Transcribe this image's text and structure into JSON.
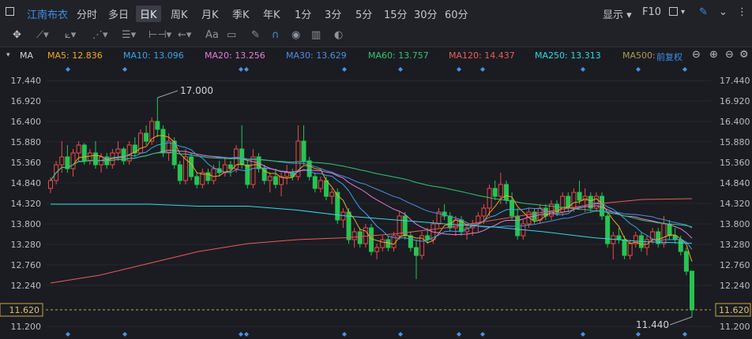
{
  "stock_name": "江南布衣",
  "periods": [
    "分时",
    "多日",
    "日K",
    "周K",
    "月K",
    "季K",
    "年K",
    "1分",
    "3分",
    "5分",
    "15分",
    "30分",
    "60分"
  ],
  "active_period": "日K",
  "toolbar_right": {
    "display_label": "显示",
    "f10_label": "F10"
  },
  "tools": {
    "text_tool": "Aa"
  },
  "indicator_label": "MA",
  "adjust_label": "前复权",
  "ma_legend": [
    {
      "label": "MA5: 12.836",
      "color": "#f5a623"
    },
    {
      "label": "MA10: 13.096",
      "color": "#3aa3f0"
    },
    {
      "label": "MA20: 13.256",
      "color": "#e87bd8"
    },
    {
      "label": "MA30: 13.629",
      "color": "#4b8fe6"
    },
    {
      "label": "MA60: 13.757",
      "color": "#35c46f"
    },
    {
      "label": "MA120: 14.437",
      "color": "#ef5a5a"
    },
    {
      "label": "MA250: 13.313",
      "color": "#36d6e7"
    },
    {
      "label": "MA500:",
      "color": "#b09a55"
    }
  ],
  "chart_data": {
    "type": "candlestick",
    "ylim": [
      11.2,
      17.6
    ],
    "y_ticks": [
      "17.440",
      "16.920",
      "16.400",
      "15.880",
      "15.360",
      "14.840",
      "14.320",
      "13.800",
      "13.280",
      "12.760",
      "12.240",
      "11.200"
    ],
    "current_price": "11.620",
    "max_label": "17.000",
    "min_label": "11.440",
    "candles": [
      [
        14.7,
        14.98,
        14.58,
        14.9
      ],
      [
        14.9,
        15.4,
        14.8,
        15.3
      ],
      [
        15.3,
        15.9,
        15.1,
        15.5
      ],
      [
        15.5,
        15.8,
        15.1,
        15.2
      ],
      [
        15.2,
        15.7,
        15.0,
        15.6
      ],
      [
        15.6,
        15.9,
        15.4,
        15.8
      ],
      [
        15.8,
        15.85,
        15.3,
        15.4
      ],
      [
        15.4,
        15.7,
        15.3,
        15.6
      ],
      [
        15.6,
        15.9,
        15.2,
        15.3
      ],
      [
        15.3,
        15.6,
        15.1,
        15.5
      ],
      [
        15.5,
        15.6,
        15.2,
        15.3
      ],
      [
        15.3,
        15.7,
        15.2,
        15.6
      ],
      [
        15.6,
        15.9,
        15.4,
        15.7
      ],
      [
        15.7,
        15.75,
        15.3,
        15.4
      ],
      [
        15.4,
        15.9,
        15.3,
        15.8
      ],
      [
        15.8,
        16.0,
        15.5,
        15.6
      ],
      [
        15.6,
        16.2,
        15.6,
        16.1
      ],
      [
        16.1,
        16.3,
        15.8,
        15.9
      ],
      [
        15.9,
        16.5,
        15.8,
        16.4
      ],
      [
        16.4,
        17.0,
        16.0,
        16.2
      ],
      [
        16.2,
        16.3,
        15.5,
        15.6
      ],
      [
        15.6,
        16.1,
        15.4,
        15.9
      ],
      [
        15.9,
        16.0,
        15.2,
        15.3
      ],
      [
        15.3,
        15.4,
        14.8,
        14.9
      ],
      [
        14.9,
        15.7,
        14.8,
        15.5
      ],
      [
        15.5,
        15.6,
        14.9,
        15.0
      ],
      [
        15.0,
        15.1,
        14.7,
        14.8
      ],
      [
        14.8,
        15.2,
        14.7,
        15.1
      ],
      [
        15.1,
        15.2,
        14.8,
        14.9
      ],
      [
        14.9,
        15.3,
        14.8,
        15.2
      ],
      [
        15.2,
        15.4,
        15.0,
        15.1
      ],
      [
        15.1,
        15.5,
        15.0,
        15.3
      ],
      [
        15.3,
        15.4,
        15.0,
        15.2
      ],
      [
        15.2,
        15.8,
        15.1,
        15.7
      ],
      [
        15.7,
        16.3,
        15.2,
        15.3
      ],
      [
        15.3,
        15.4,
        14.7,
        14.8
      ],
      [
        14.8,
        15.7,
        14.7,
        15.5
      ],
      [
        15.5,
        15.6,
        15.1,
        15.2
      ],
      [
        15.2,
        15.3,
        14.8,
        14.9
      ],
      [
        14.9,
        15.1,
        14.6,
        15.0
      ],
      [
        15.0,
        15.2,
        14.7,
        14.8
      ],
      [
        14.8,
        15.1,
        14.5,
        15.0
      ],
      [
        15.0,
        15.3,
        14.8,
        15.1
      ],
      [
        15.1,
        15.2,
        14.9,
        15.0
      ],
      [
        15.0,
        16.3,
        14.9,
        15.9
      ],
      [
        15.9,
        16.3,
        15.3,
        15.4
      ],
      [
        15.4,
        15.5,
        14.9,
        15.0
      ],
      [
        15.0,
        15.1,
        14.6,
        14.7
      ],
      [
        14.7,
        15.0,
        14.6,
        14.9
      ],
      [
        14.9,
        15.0,
        14.4,
        14.5
      ],
      [
        14.5,
        14.7,
        14.3,
        14.6
      ],
      [
        14.6,
        14.7,
        13.8,
        13.9
      ],
      [
        13.9,
        14.2,
        13.7,
        14.1
      ],
      [
        14.1,
        14.2,
        13.3,
        13.4
      ],
      [
        13.4,
        13.7,
        13.2,
        13.6
      ],
      [
        13.6,
        13.7,
        13.2,
        13.3
      ],
      [
        13.3,
        13.8,
        13.2,
        13.7
      ],
      [
        13.7,
        13.8,
        13.0,
        13.1
      ],
      [
        13.1,
        13.3,
        12.9,
        13.2
      ],
      [
        13.2,
        13.5,
        13.1,
        13.4
      ],
      [
        13.4,
        13.5,
        13.1,
        13.2
      ],
      [
        13.2,
        13.6,
        13.1,
        13.5
      ],
      [
        13.5,
        14.1,
        13.4,
        14.0
      ],
      [
        14.0,
        14.1,
        13.4,
        13.5
      ],
      [
        13.5,
        13.6,
        13.1,
        13.2
      ],
      [
        13.2,
        13.4,
        12.4,
        13.0
      ],
      [
        13.0,
        13.6,
        12.9,
        13.5
      ],
      [
        13.5,
        13.7,
        13.3,
        13.4
      ],
      [
        13.4,
        13.9,
        13.3,
        13.8
      ],
      [
        13.8,
        14.2,
        13.7,
        14.1
      ],
      [
        14.1,
        14.3,
        13.9,
        14.0
      ],
      [
        14.0,
        14.1,
        13.6,
        13.7
      ],
      [
        13.7,
        14.0,
        13.5,
        13.9
      ],
      [
        13.9,
        14.0,
        13.5,
        13.6
      ],
      [
        13.6,
        13.8,
        13.4,
        13.7
      ],
      [
        13.7,
        13.9,
        13.5,
        13.8
      ],
      [
        13.8,
        14.1,
        13.6,
        14.0
      ],
      [
        14.0,
        14.3,
        13.8,
        14.2
      ],
      [
        14.2,
        14.8,
        14.0,
        14.7
      ],
      [
        14.7,
        14.9,
        14.4,
        14.5
      ],
      [
        14.5,
        15.1,
        14.3,
        14.8
      ],
      [
        14.8,
        14.9,
        14.3,
        14.4
      ],
      [
        14.4,
        14.6,
        13.9,
        14.0
      ],
      [
        14.0,
        14.2,
        13.4,
        13.5
      ],
      [
        13.5,
        13.9,
        13.4,
        13.8
      ],
      [
        13.8,
        14.2,
        13.7,
        14.1
      ],
      [
        14.1,
        14.2,
        13.8,
        13.9
      ],
      [
        13.9,
        14.3,
        13.8,
        14.2
      ],
      [
        14.2,
        14.3,
        13.9,
        14.0
      ],
      [
        14.0,
        14.4,
        13.9,
        14.3
      ],
      [
        14.3,
        14.4,
        14.0,
        14.1
      ],
      [
        14.1,
        14.6,
        14.0,
        14.5
      ],
      [
        14.5,
        14.6,
        14.1,
        14.2
      ],
      [
        14.2,
        14.7,
        14.1,
        14.6
      ],
      [
        14.6,
        14.9,
        14.3,
        14.4
      ],
      [
        14.4,
        14.7,
        14.1,
        14.5
      ],
      [
        14.5,
        14.6,
        14.1,
        14.2
      ],
      [
        14.2,
        14.6,
        14.1,
        14.5
      ],
      [
        14.5,
        14.6,
        13.9,
        14.0
      ],
      [
        14.0,
        14.1,
        13.2,
        13.3
      ],
      [
        13.3,
        13.6,
        12.9,
        13.5
      ],
      [
        13.5,
        13.7,
        13.3,
        13.4
      ],
      [
        13.4,
        13.5,
        12.9,
        13.0
      ],
      [
        13.0,
        13.4,
        12.9,
        13.3
      ],
      [
        13.3,
        13.6,
        13.2,
        13.5
      ],
      [
        13.5,
        13.6,
        13.1,
        13.2
      ],
      [
        13.2,
        13.5,
        13.0,
        13.4
      ],
      [
        13.4,
        13.7,
        13.3,
        13.6
      ],
      [
        13.6,
        13.7,
        13.2,
        13.3
      ],
      [
        13.3,
        14.0,
        13.2,
        13.8
      ],
      [
        13.8,
        13.9,
        13.4,
        13.5
      ],
      [
        13.5,
        13.7,
        13.3,
        13.4
      ],
      [
        13.4,
        13.5,
        13.0,
        13.1
      ],
      [
        13.1,
        13.2,
        12.5,
        12.6
      ],
      [
        12.6,
        12.6,
        11.44,
        11.62
      ]
    ]
  }
}
